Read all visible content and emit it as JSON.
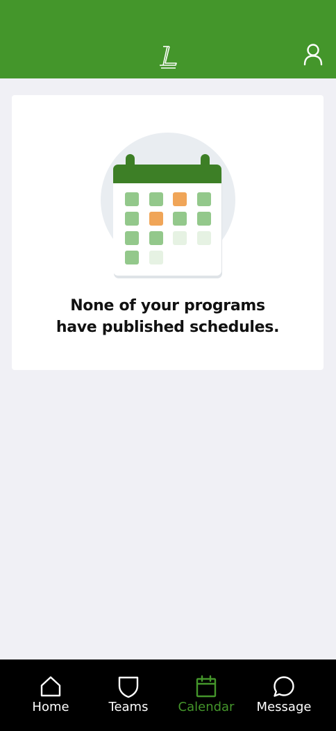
{
  "header": {
    "logo_icon": "stylized-L-logo-icon",
    "profile_icon": "person-icon",
    "background_color": "#44962b"
  },
  "empty_state": {
    "illustration_icon": "calendar-illustration",
    "message": "None of your programs have published schedules."
  },
  "bottom_nav": {
    "items": [
      {
        "label": "Home",
        "icon": "home-icon"
      },
      {
        "label": "Teams",
        "icon": "shield-icon"
      },
      {
        "label": "Calendar",
        "icon": "calendar-icon",
        "active": true
      },
      {
        "label": "Message",
        "icon": "chat-bubble-icon"
      }
    ],
    "active_color": "#44962b"
  }
}
